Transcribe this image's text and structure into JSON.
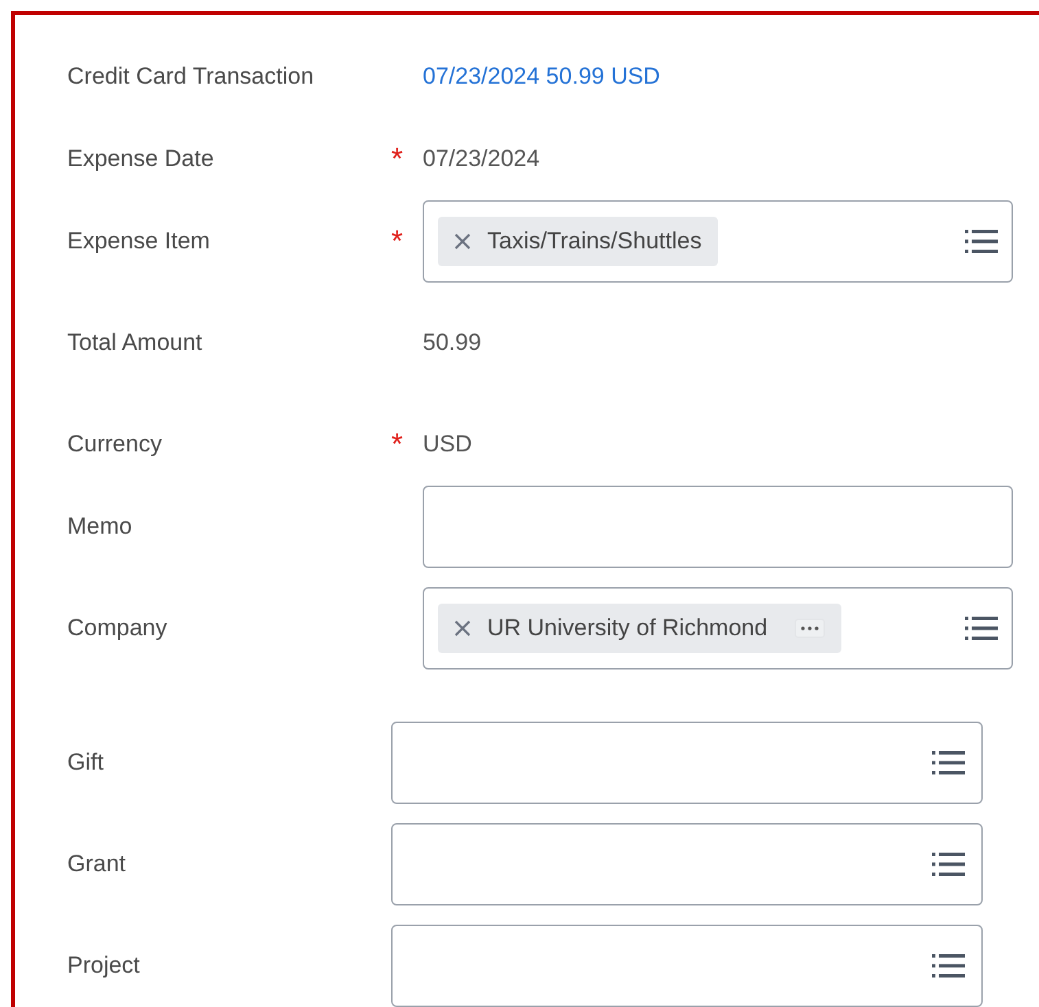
{
  "sections": [
    {
      "rows": [
        {
          "kind": "link",
          "label": "Credit Card Transaction",
          "value": "07/23/2024 50.99 USD"
        },
        {
          "kind": "text",
          "label": "Expense Date",
          "required_marker": "*",
          "value": "07/23/2024"
        },
        {
          "kind": "multiselect",
          "label": "Expense Item",
          "required_marker": "*",
          "tokens": [
            {
              "text": "Taxis/Trains/Shuttles",
              "has_more": false
            }
          ]
        },
        {
          "kind": "text",
          "label": "Total Amount",
          "value": "50.99"
        },
        {
          "kind": "text",
          "label": "Currency",
          "required_marker": "*",
          "value": "USD"
        },
        {
          "kind": "input",
          "label": "Memo"
        },
        {
          "kind": "multiselect",
          "label": "Company",
          "tokens": [
            {
              "text": "UR University of Richmond",
              "has_more": true
            }
          ]
        }
      ]
    },
    {
      "rows": [
        {
          "kind": "prompt",
          "label": "Gift"
        },
        {
          "kind": "prompt",
          "label": "Grant"
        },
        {
          "kind": "prompt",
          "label": "Project"
        }
      ]
    }
  ]
}
